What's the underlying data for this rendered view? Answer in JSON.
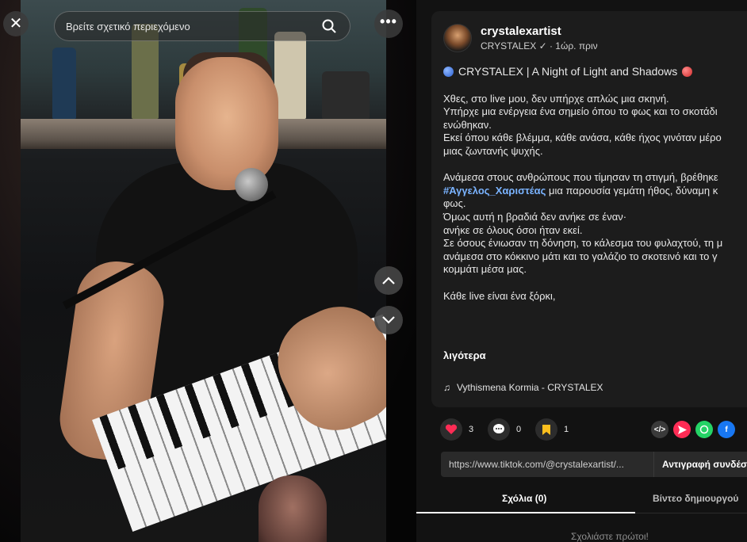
{
  "search": {
    "placeholder": "Βρείτε σχετικό περιεχόμενο"
  },
  "stage": {
    "close_symbol": "✕",
    "more_symbol": "•••"
  },
  "author": {
    "username": "crystalexartist",
    "meta": "CRYSTALEX ✓ · 1ώρ. πριν"
  },
  "caption": {
    "title": "CRYSTALEX | A Night of Light and Shadows",
    "lines_block1": [
      "Χθες, στο live μου, δεν υπήρχε απλώς μια σκηνή.",
      "Υπήρχε μια ενέργεια ένα σημείο όπου το φως και το σκοτάδι",
      "ενώθηκαν.",
      "Εκεί όπου κάθε βλέμμα, κάθε ανάσα, κάθε ήχος γινόταν μέρο",
      "μιας ζωντανής ψυχής."
    ],
    "line_block2_a": "Ανάμεσα στους ανθρώπους που τίμησαν τη στιγμή, βρέθηκε",
    "hashtag": "#Άγγελος_Χαριστέας",
    "line_block2_b_rest": " μια παρουσία γεμάτη ήθος, δύναμη κ",
    "lines_block2_tail": [
      "φως.",
      "Όμως αυτή η βραδιά δεν ανήκε σε έναν·",
      "ανήκε σε όλους όσοι ήταν εκεί.",
      "Σε όσους ένιωσαν τη δόνηση, το κάλεσμα του φυλαχτού, τη μ",
      "ανάμεσα στο κόκκινο μάτι και το γαλάζιο το σκοτεινό και το γ",
      "κομμάτι μέσα μας."
    ],
    "closing": "Κάθε live είναι ένα ξόρκι,"
  },
  "more_label": "λιγότερα",
  "music": {
    "icon": "♫",
    "title": "Vythismena Kormia - CRYSTALEX"
  },
  "actions": {
    "likes": "3",
    "comments": "0",
    "saves": "1"
  },
  "share_link": {
    "url": "https://www.tiktok.com/@crystalexartist/...",
    "copy_label": "Αντιγραφή συνδέσ"
  },
  "tabs": {
    "comments": "Σχόλια (0)",
    "creator_videos": "Βίντεο δημιουργού"
  },
  "empty_comments": "Σχολιάστε πρώτοι!",
  "colors": {
    "accent_red": "#fe2c55",
    "hashtag_blue": "#7ab3ff",
    "panel_bg": "#121212",
    "card_bg": "#1c1c1c"
  }
}
